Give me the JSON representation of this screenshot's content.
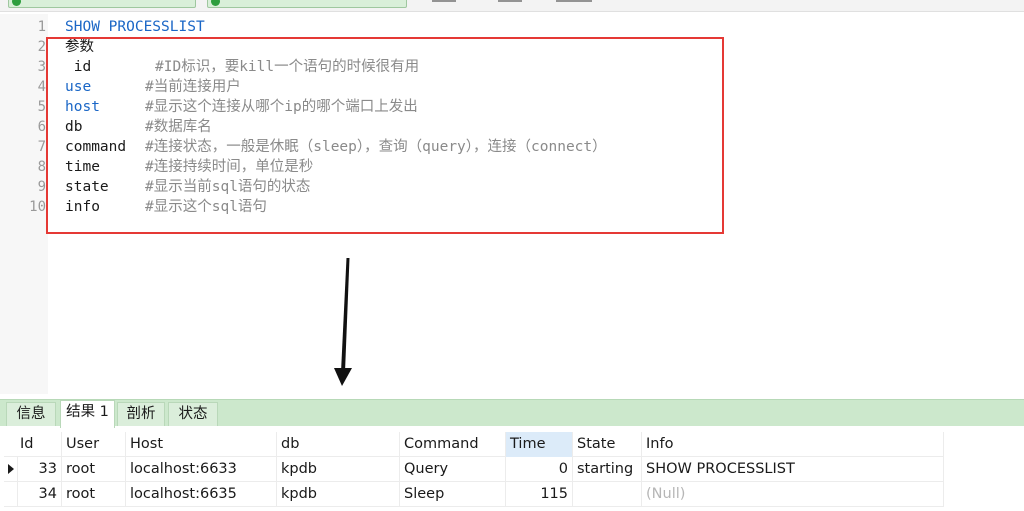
{
  "editor": {
    "lines": [
      {
        "no": "1",
        "parts": [
          {
            "t": "SHOW PROCESSLIST",
            "c": "kw"
          }
        ]
      },
      {
        "no": "2",
        "parts": [
          {
            "t": "参数",
            "c": "id"
          }
        ]
      },
      {
        "no": "3",
        "parts": [
          {
            "t": " id",
            "c": "id"
          },
          {
            "t": "#ID标识，要kill一个语句的时候很有用",
            "c": "cm"
          }
        ]
      },
      {
        "no": "4",
        "parts": [
          {
            "t": "use",
            "c": "kw"
          },
          {
            "t": "#当前连接用户",
            "c": "cm"
          }
        ]
      },
      {
        "no": "5",
        "parts": [
          {
            "t": "host",
            "c": "kw"
          },
          {
            "t": "#显示这个连接从哪个ip的哪个端口上发出",
            "c": "cm"
          }
        ]
      },
      {
        "no": "6",
        "parts": [
          {
            "t": "db",
            "c": "id"
          },
          {
            "t": "#数据库名",
            "c": "cm"
          }
        ]
      },
      {
        "no": "7",
        "parts": [
          {
            "t": "command",
            "c": "id"
          },
          {
            "t": "#连接状态，一般是休眠（sleep），查询（query），连接（connect）",
            "c": "cm"
          }
        ]
      },
      {
        "no": "8",
        "parts": [
          {
            "t": "time",
            "c": "id"
          },
          {
            "t": "#连接持续时间，单位是秒",
            "c": "cm"
          }
        ]
      },
      {
        "no": "9",
        "parts": [
          {
            "t": "state",
            "c": "id"
          },
          {
            "t": "#显示当前sql语句的状态",
            "c": "cm"
          }
        ]
      },
      {
        "no": "10",
        "parts": [
          {
            "t": "info",
            "c": "id"
          },
          {
            "t": "#显示这个sql语句",
            "c": "cm"
          }
        ]
      }
    ]
  },
  "result_tabs": [
    {
      "label": "信息",
      "active": false
    },
    {
      "label": "结果 1",
      "active": true
    },
    {
      "label": "剖析",
      "active": false
    },
    {
      "label": "状态",
      "active": false
    }
  ],
  "grid": {
    "columns": [
      "Id",
      "User",
      "Host",
      "db",
      "Command",
      "Time",
      "State",
      "Info"
    ],
    "sorted_column": "Time",
    "rows": [
      {
        "current": true,
        "cells": [
          "33",
          "root",
          "localhost:6633",
          "kpdb",
          "Query",
          "0",
          "starting",
          "SHOW PROCESSLIST"
        ]
      },
      {
        "current": false,
        "cells": [
          "34",
          "root",
          "localhost:6635",
          "kpdb",
          "Sleep",
          "115",
          "",
          "(Null)"
        ]
      }
    ]
  },
  "colors": {
    "keyword": "#1a66c6",
    "comment": "#8a8a8a",
    "highlight_border": "#e53935",
    "tabbar_bg": "#cce8cc",
    "sorted_column_bg": "#dcebf9",
    "null_text": "#b6b6b6"
  },
  "icons": [
    "green-db-icon",
    "arrow-down-icon",
    "row-pointer-icon"
  ]
}
